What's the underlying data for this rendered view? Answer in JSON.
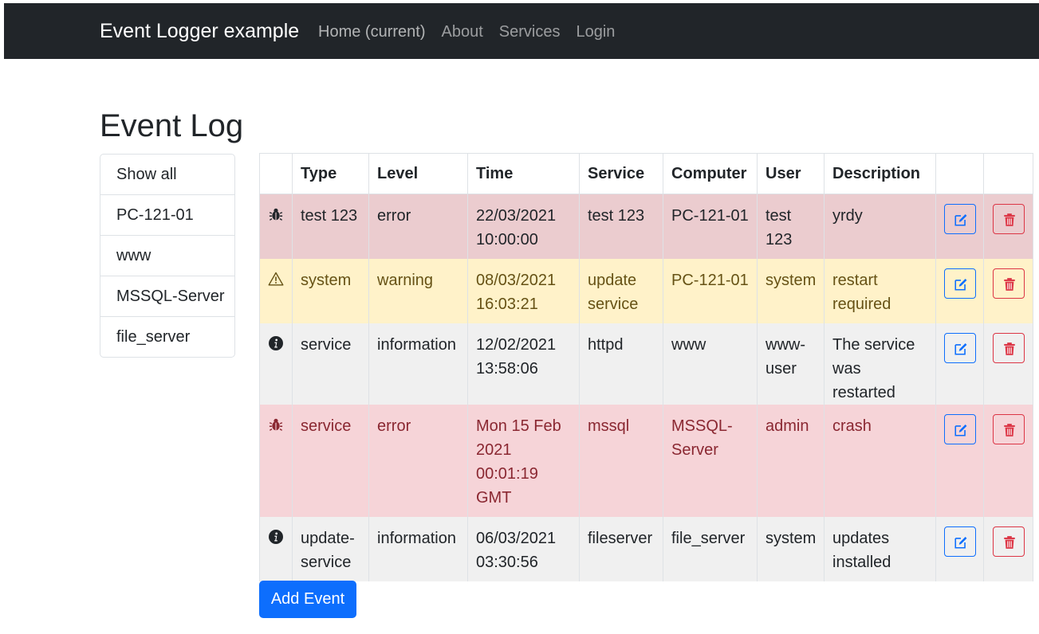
{
  "navbar": {
    "brand": "Event Logger example",
    "links": [
      "Home (current)",
      "About",
      "Services",
      "Login"
    ]
  },
  "page": {
    "title": "Event Log"
  },
  "filters": [
    "Show all",
    "PC-121-01",
    "www",
    "MSSQL-Server",
    "file_server"
  ],
  "table": {
    "headers": [
      "Type",
      "Level",
      "Time",
      "Service",
      "Computer",
      "User",
      "Description"
    ],
    "rows": [
      {
        "icon": "bug-icon",
        "type": "test 123",
        "level": "error",
        "time": "22/03/2021 10:00:00",
        "service": "test 123",
        "computer": "PC-121-01",
        "user": "test 123",
        "description": "yrdy"
      },
      {
        "icon": "warning-icon",
        "type": "system",
        "level": "warning",
        "time": "08/03/2021 16:03:21",
        "service": "update service",
        "computer": "PC-121-01",
        "user": "system",
        "description": "restart required"
      },
      {
        "icon": "info-icon",
        "type": "service",
        "level": "information",
        "time": "12/02/2021 13:58:06",
        "service": "httpd",
        "computer": "www",
        "user": "www-user",
        "description": "The service was restarted"
      },
      {
        "icon": "bug-icon",
        "type": "service",
        "level": "error",
        "time": "Mon 15 Feb 2021 00:01:19 GMT",
        "service": "mssql",
        "computer": "MSSQL-Server",
        "user": "admin",
        "description": "crash"
      },
      {
        "icon": "info-icon",
        "type": "update-service",
        "level": "information",
        "time": "06/03/2021 03:30:56",
        "service": "fileserver",
        "computer": "file_server",
        "user": "system",
        "description": "updates installed"
      }
    ]
  },
  "actions": {
    "add_event": "Add Event"
  },
  "colors": {
    "navbar": "#212529",
    "primary": "#0d6efd",
    "danger": "#dc3545",
    "row_error": "#ebcccf",
    "row_warning": "#fff2c9",
    "row_info": "#f0f0f0",
    "row_error_alt": "#f6d4d8"
  }
}
